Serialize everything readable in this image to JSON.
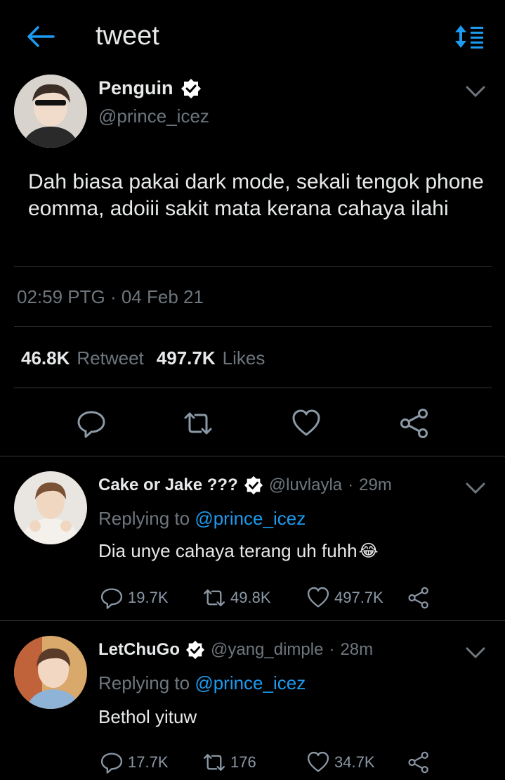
{
  "header": {
    "title": "tweet",
    "back_icon": "arrow-left-icon",
    "sort_icon": "sort-icon",
    "accent": "#1d9bf0"
  },
  "tweet": {
    "author_name": "Penguin",
    "author_handle": "@prince_icez",
    "verified": true,
    "text": "Dah biasa pakai dark mode, sekali  tengok phone eomma, adoiii sakit mata kerana cahaya ilahi",
    "timestamp": "02:59 PTG · 04 Feb 21",
    "retweets_count": "46.8K",
    "retweets_label": "Retweet",
    "likes_count": "497.7K",
    "likes_label": "Likes"
  },
  "replies": [
    {
      "name": "Cake or Jake ???",
      "handle": "@luvlayla",
      "time": "29m",
      "verified": true,
      "replying_prefix": "Replying to",
      "replying_to": "@prince_icez",
      "text": "Dia unye cahaya terang uh fuhh",
      "emoji": "😂",
      "replies_count": "19.7K",
      "retweets_count": "49.8K",
      "likes_count": "497.7K"
    },
    {
      "name": "LetChuGo",
      "handle": "@yang_dimple",
      "time": "28m",
      "verified": true,
      "replying_prefix": "Replying to",
      "replying_to": "@prince_icez",
      "text": "Bethol yituw",
      "replies_count": "17.7K",
      "retweets_count": "176",
      "likes_count": "34.7K"
    }
  ]
}
